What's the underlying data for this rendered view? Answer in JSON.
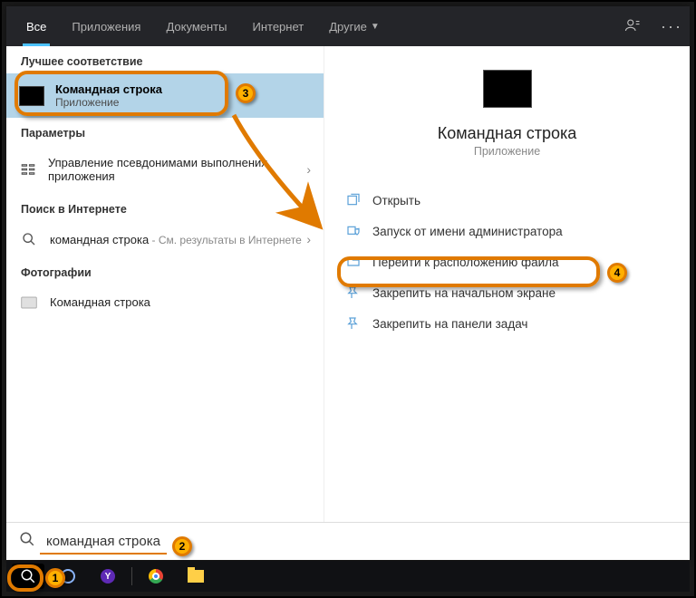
{
  "tabs": {
    "all": "Все",
    "apps": "Приложения",
    "docs": "Документы",
    "internet": "Интернет",
    "more": "Другие"
  },
  "sections": {
    "best_match": "Лучшее соответствие",
    "settings": "Параметры",
    "web": "Поиск в Интернете",
    "photos": "Фотографии"
  },
  "best_match_item": {
    "title": "Командная строка",
    "subtitle": "Приложение"
  },
  "settings_item": {
    "title": "Управление псевдонимами выполнения приложения"
  },
  "web_item": {
    "title": "командная строка",
    "subtitle": " - См. результаты в Интернете"
  },
  "photos_item": {
    "title": "Командная строка"
  },
  "preview": {
    "title": "Командная строка",
    "subtitle": "Приложение"
  },
  "actions": {
    "open": "Открыть",
    "run_as_admin": "Запуск от имени администратора",
    "file_location": "Перейти к расположению файла",
    "pin_start": "Закрепить на начальном экране",
    "pin_taskbar": "Закрепить на панели задач"
  },
  "search": {
    "value": "командная строка"
  },
  "annotations": {
    "n1": "1",
    "n2": "2",
    "n3": "3",
    "n4": "4"
  }
}
